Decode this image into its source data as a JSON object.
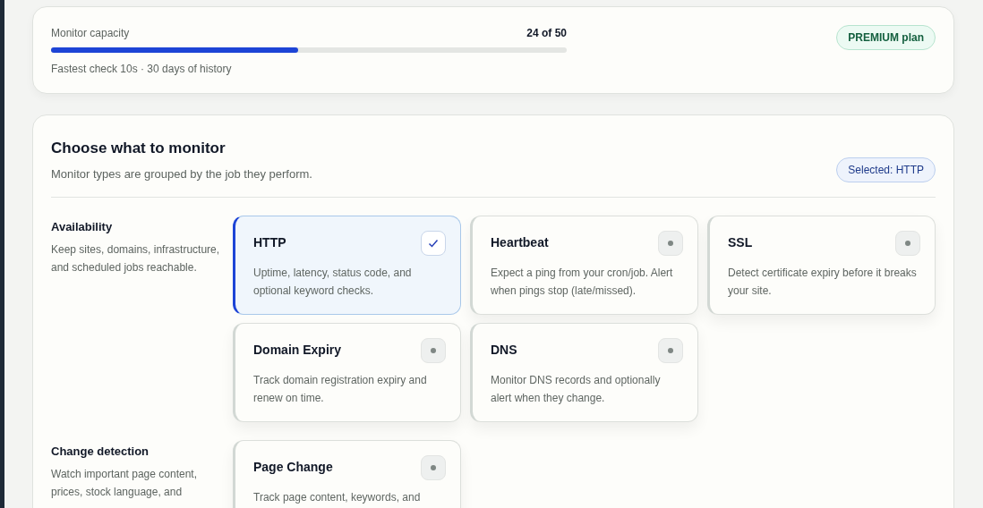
{
  "capacity": {
    "label": "Monitor capacity",
    "count": "24 of 50",
    "level": 0.48,
    "note": "Fastest check 10s · 30 days of history",
    "plan_badge": "PREMIUM plan"
  },
  "chooser": {
    "title": "Choose what to monitor",
    "subtitle": "Monitor types are grouped by the job they perform.",
    "selected_badge": "Selected: HTTP",
    "groups": [
      {
        "title": "Availability",
        "description": "Keep sites, domains, infrastructure, and scheduled jobs reachable.",
        "types": [
          {
            "name": "HTTP",
            "description": "Uptime, latency, status code, and optional keyword checks.",
            "selected": true
          },
          {
            "name": "Heartbeat",
            "description": "Expect a ping from your cron/job. Alert when pings stop (late/missed).",
            "selected": false
          },
          {
            "name": "SSL",
            "description": "Detect certificate expiry before it breaks your site.",
            "selected": false
          },
          {
            "name": "Domain Expiry",
            "description": "Track domain registration expiry and renew on time.",
            "selected": false
          },
          {
            "name": "DNS",
            "description": "Monitor DNS records and optionally alert when they change.",
            "selected": false
          }
        ]
      },
      {
        "title": "Change detection",
        "description": "Watch important page content, prices, stock language, and",
        "types": [
          {
            "name": "Page Change",
            "description": "Track page content, keywords, and",
            "selected": false
          }
        ]
      }
    ]
  }
}
